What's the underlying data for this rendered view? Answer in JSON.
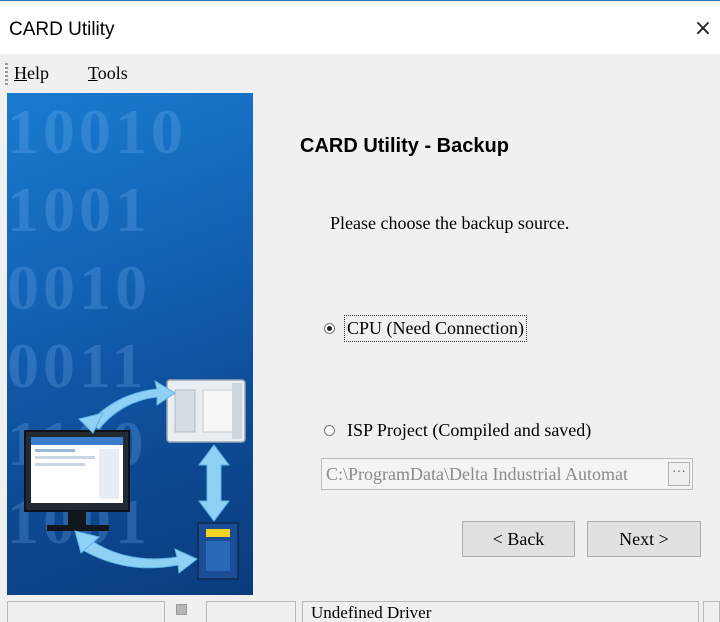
{
  "window": {
    "title": "CARD Utility",
    "close_glyph": "×"
  },
  "menu": {
    "help": {
      "accel": "H",
      "rest": "elp"
    },
    "tools": {
      "accel": "T",
      "rest": "ools"
    }
  },
  "banner": {
    "bits": "10010\n1001\n0010\n0011\n1100\n1001"
  },
  "wizard": {
    "heading": "CARD Utility - Backup",
    "prompt": "Please choose the backup source.",
    "options": [
      {
        "label": "CPU (Need Connection)",
        "selected": true
      },
      {
        "label": "ISP Project (Compiled and saved)",
        "selected": false
      }
    ],
    "path_value": "C:\\ProgramData\\Delta Industrial Automat",
    "browse_label": "···",
    "back_label": "< Back",
    "next_label": "Next >"
  },
  "status": {
    "driver": "Undefined Driver"
  },
  "icons": [
    "close-icon",
    "monitor-icon",
    "plc-icon",
    "memory-card-icon",
    "sync-arrows-icon"
  ],
  "colors": {
    "banner_blue": "#1363b6",
    "arrow": "#8fd0f5",
    "accent_line": "#2a7ab8"
  }
}
